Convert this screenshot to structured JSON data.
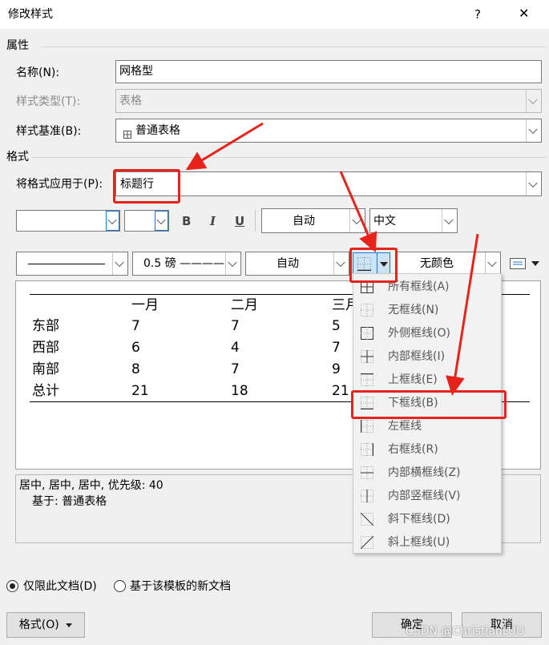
{
  "window": {
    "title": "修改样式",
    "help": "?",
    "close": "✕"
  },
  "properties": {
    "section": "属性",
    "name_label": "名称(N):",
    "name_value": "网格型",
    "type_label": "样式类型(T):",
    "type_value": "表格",
    "base_label": "样式基准(B):",
    "base_value": "普通表格"
  },
  "format": {
    "section": "格式",
    "apply_label": "将格式应用于(P):",
    "apply_value": "标题行",
    "bold": "B",
    "italic": "I",
    "underline": "U",
    "font_color": "自动",
    "script": "中文",
    "line_weight": "0.5 磅 ————",
    "border_color": "自动",
    "shading": "无颜色"
  },
  "preview": {
    "headers": [
      "一月",
      "二月",
      "三月"
    ],
    "rows": [
      {
        "label": "东部",
        "values": [
          "7",
          "7",
          "5"
        ]
      },
      {
        "label": "西部",
        "values": [
          "6",
          "4",
          "7"
        ]
      },
      {
        "label": "南部",
        "values": [
          "8",
          "7",
          "9"
        ]
      },
      {
        "label": "总计",
        "values": [
          "21",
          "18",
          "21"
        ]
      }
    ]
  },
  "description": {
    "line1": "居中, 居中, 居中, 优先级: 40",
    "line2": "基于: 普通表格"
  },
  "border_menu": {
    "items": [
      "所有框线(A)",
      "无框线(N)",
      "外侧框线(O)",
      "内部框线(I)",
      "上框线(E)",
      "下框线(B)",
      "左框线",
      "右框线(R)",
      "内部横框线(Z)",
      "内部竖框线(V)",
      "斜下框线(D)",
      "斜上框线(U)"
    ],
    "selected": "下框线(B)"
  },
  "options": {
    "only_doc": "仅限此文档(D)",
    "new_docs": "基于该模板的新文档"
  },
  "buttons": {
    "format": "格式(O)",
    "ok": "确定",
    "cancel": "取消"
  },
  "watermark": "CSDN @ChristianLUU",
  "colors": {
    "annotation": "#e8231c",
    "selection": "#cce4f7"
  }
}
